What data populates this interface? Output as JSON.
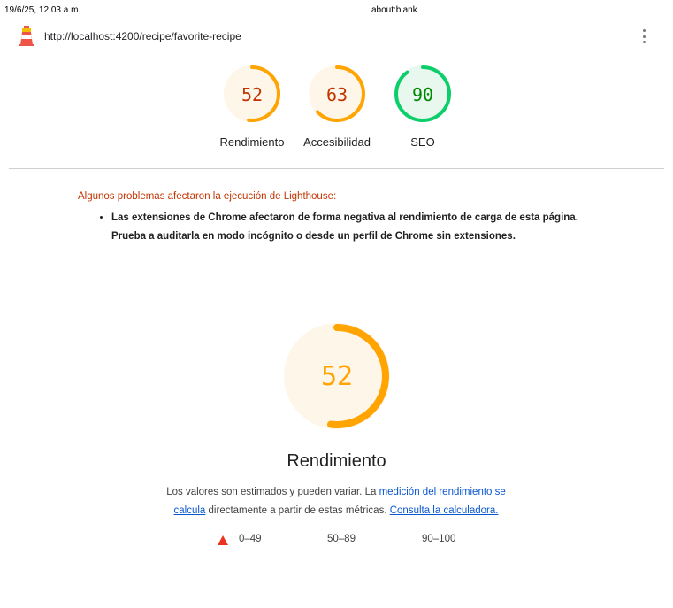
{
  "print_header": {
    "date": "19/6/25, 12:03 a.m.",
    "title": "about:blank"
  },
  "topbar": {
    "logo_icon": "lighthouse-icon",
    "url": "http://localhost:4200/recipe/favorite-recipe",
    "menu_icon": "more-vertical-icon"
  },
  "gauges": [
    {
      "label": "Rendimiento",
      "score": "52",
      "score_value": 52,
      "color": "#ffa400",
      "text_color": "#c33300",
      "bg": "#fff6ea"
    },
    {
      "label": "Accesibilidad",
      "score": "63",
      "score_value": 63,
      "color": "#ffa400",
      "text_color": "#c33300",
      "bg": "#fff6ea"
    },
    {
      "label": "SEO",
      "score": "90",
      "score_value": 90,
      "color": "#0cce6b",
      "text_color": "#008800",
      "bg": "#e8f8ee"
    }
  ],
  "warnings": {
    "title": "Algunos problemas afectaron la ejecución de Lighthouse:",
    "items": [
      "Las extensiones de Chrome afectaron de forma negativa al rendimiento de carga de esta página. Prueba a auditarla en modo incógnito o desde un perfil de Chrome sin extensiones."
    ]
  },
  "performance": {
    "score": "52",
    "score_value": 52,
    "color": "#ffa400",
    "text_color": "#ffa400",
    "bg": "#fff6ea",
    "title": "Rendimiento",
    "desc_prefix": "Los valores son estimados y pueden variar. La ",
    "desc_link1": "medición del rendimiento se calcula",
    "desc_middle": " directamente a partir de estas métricas. ",
    "desc_link2": "Consulta la calculadora."
  },
  "legend": {
    "fail": "0–49",
    "average": "50–89",
    "pass": "90–100",
    "fail_color": "#e8341e"
  }
}
